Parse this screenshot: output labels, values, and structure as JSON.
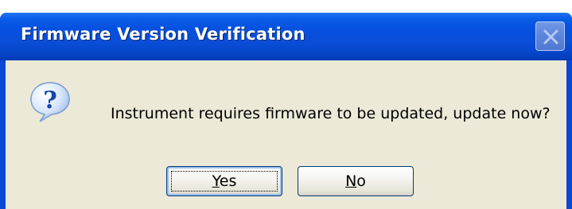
{
  "dialog": {
    "title": "Firmware Version Verification",
    "message": "Instrument requires firmware to be updated, update now?",
    "icon": "question-icon",
    "close_icon": "close-icon"
  },
  "buttons": {
    "yes": {
      "access_key": "Y",
      "rest": "es"
    },
    "no": {
      "access_key": "N",
      "rest": "o"
    }
  },
  "colors": {
    "titlebar": "#0550df",
    "title_text": "#ffffff",
    "client_background": "#ece9d8",
    "button_border": "#003c74"
  }
}
